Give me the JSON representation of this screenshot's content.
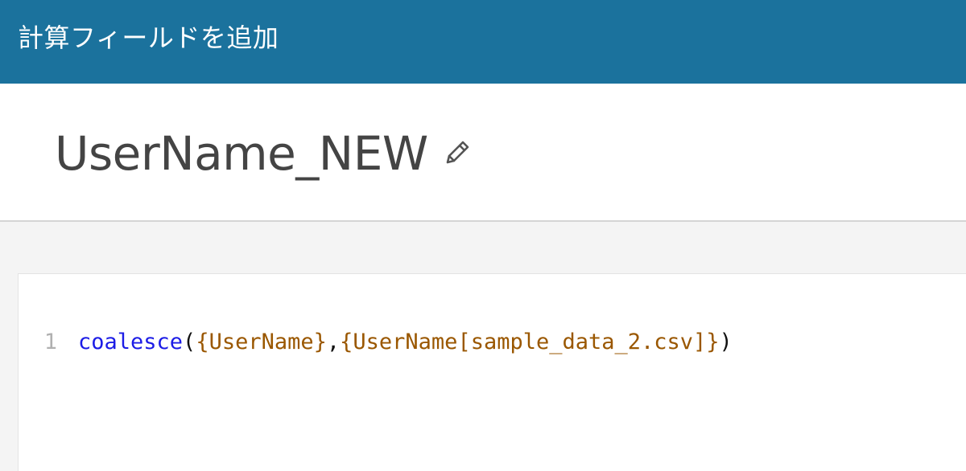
{
  "header": {
    "title": "計算フィールドを追加"
  },
  "field": {
    "name": "UserName_NEW",
    "edit_icon": "pencil-icon"
  },
  "editor": {
    "line_number": "1",
    "tokens": {
      "function": "coalesce",
      "open_paren": "(",
      "arg1": "{UserName}",
      "comma": ",",
      "arg2": "{UserName[sample_data_2.csv]}",
      "close_paren": ")"
    }
  },
  "colors": {
    "header_bg": "#1b729d",
    "function": "#1c1ce6",
    "field_ref": "#9a5700",
    "line_number": "#b0b0b0"
  }
}
